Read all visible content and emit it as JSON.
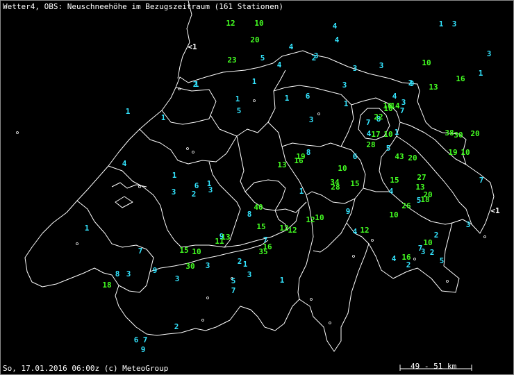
{
  "title": "Wetter4, OBS: Neuschneehöhe im Bezugszeitraum (161 Stationen)",
  "footer": "So, 17.01.2016 06:00z (c) MeteoGroup",
  "scale_label": "49 - 51 km",
  "colors": {
    "cyan": "#33e5ff",
    "green": "#44ff22",
    "white": "#ffffff"
  },
  "stations": [
    {
      "t": "12",
      "c": "g"
    },
    {
      "t": "10",
      "c": "g"
    },
    {
      "t": "20",
      "c": "g"
    },
    {
      "t": "23",
      "c": "g"
    },
    {
      "t": "5",
      "c": "c"
    },
    {
      "t": "4",
      "c": "c"
    },
    {
      "t": "3",
      "c": "c"
    },
    {
      "t": "4",
      "c": "c"
    },
    {
      "t": "1",
      "c": "c"
    },
    {
      "t": "1",
      "c": "c"
    },
    {
      "t": "4",
      "c": "c"
    },
    {
      "t": "4",
      "c": "c"
    },
    {
      "t": "3",
      "c": "c"
    },
    {
      "t": "2",
      "c": "c"
    },
    {
      "t": "3",
      "c": "c"
    },
    {
      "t": "<1",
      "c": "w"
    },
    {
      "t": "2",
      "c": "c"
    },
    {
      "t": "1",
      "c": "c"
    },
    {
      "t": "3",
      "c": "c"
    },
    {
      "t": "3",
      "c": "c"
    },
    {
      "t": "1",
      "c": "c"
    },
    {
      "t": "6",
      "c": "c"
    },
    {
      "t": "3",
      "c": "c"
    },
    {
      "t": "3",
      "c": "c"
    },
    {
      "t": "10",
      "c": "g"
    },
    {
      "t": "2",
      "c": "c"
    },
    {
      "t": "10",
      "c": "g"
    },
    {
      "t": "3",
      "c": "c"
    },
    {
      "t": "9",
      "c": "c"
    },
    {
      "t": "13",
      "c": "g"
    },
    {
      "t": "16",
      "c": "g"
    },
    {
      "t": "7",
      "c": "c"
    },
    {
      "t": "4",
      "c": "c"
    },
    {
      "t": "1",
      "c": "c"
    },
    {
      "t": "1",
      "c": "c"
    },
    {
      "t": "14",
      "c": "g"
    },
    {
      "t": "10",
      "c": "g"
    },
    {
      "t": "8",
      "c": "c"
    },
    {
      "t": "22",
      "c": "g"
    },
    {
      "t": "7",
      "c": "c"
    },
    {
      "t": "4",
      "c": "c"
    },
    {
      "t": "17",
      "c": "g"
    },
    {
      "t": "10",
      "c": "g"
    },
    {
      "t": "1",
      "c": "c"
    },
    {
      "t": "28",
      "c": "g"
    },
    {
      "t": "5",
      "c": "c"
    },
    {
      "t": "43",
      "c": "g"
    },
    {
      "t": "20",
      "c": "g"
    },
    {
      "t": "38",
      "c": "g"
    },
    {
      "t": "30",
      "c": "g"
    },
    {
      "t": "20",
      "c": "g"
    },
    {
      "t": "19",
      "c": "g"
    },
    {
      "t": "10",
      "c": "g"
    },
    {
      "t": "1",
      "c": "c"
    },
    {
      "t": "1",
      "c": "c"
    },
    {
      "t": "4",
      "c": "c"
    },
    {
      "t": "1",
      "c": "c"
    },
    {
      "t": "3",
      "c": "c"
    },
    {
      "t": "6",
      "c": "c"
    },
    {
      "t": "2",
      "c": "c"
    },
    {
      "t": "1",
      "c": "c"
    },
    {
      "t": "3",
      "c": "c"
    },
    {
      "t": "13",
      "c": "g"
    },
    {
      "t": "16",
      "c": "g"
    },
    {
      "t": "19",
      "c": "g"
    },
    {
      "t": "8",
      "c": "c"
    },
    {
      "t": "6",
      "c": "c"
    },
    {
      "t": "10",
      "c": "g"
    },
    {
      "t": "1",
      "c": "c"
    },
    {
      "t": "34",
      "c": "g"
    },
    {
      "t": "28",
      "c": "g"
    },
    {
      "t": "15",
      "c": "g"
    },
    {
      "t": "15",
      "c": "g"
    },
    {
      "t": "4",
      "c": "c"
    },
    {
      "t": "27",
      "c": "g"
    },
    {
      "t": "13",
      "c": "g"
    },
    {
      "t": "20",
      "c": "g"
    },
    {
      "t": "5",
      "c": "c"
    },
    {
      "t": "18",
      "c": "g"
    },
    {
      "t": "26",
      "c": "g"
    },
    {
      "t": "10",
      "c": "g"
    },
    {
      "t": "7",
      "c": "c"
    },
    {
      "t": "<1",
      "c": "w"
    },
    {
      "t": "3",
      "c": "c"
    },
    {
      "t": "1",
      "c": "c"
    },
    {
      "t": "5",
      "c": "c"
    },
    {
      "t": "40",
      "c": "g"
    },
    {
      "t": "8",
      "c": "c"
    },
    {
      "t": "15",
      "c": "g"
    },
    {
      "t": "12",
      "c": "g"
    },
    {
      "t": "12",
      "c": "g"
    },
    {
      "t": "12",
      "c": "g"
    },
    {
      "t": "10",
      "c": "g"
    },
    {
      "t": "9",
      "c": "c"
    },
    {
      "t": "4",
      "c": "c"
    },
    {
      "t": "12",
      "c": "g"
    },
    {
      "t": "7",
      "c": "c"
    },
    {
      "t": "15",
      "c": "g"
    },
    {
      "t": "10",
      "c": "g"
    },
    {
      "t": "9",
      "c": "c"
    },
    {
      "t": "11",
      "c": "g"
    },
    {
      "t": "9",
      "c": "c"
    },
    {
      "t": "13",
      "c": "g"
    },
    {
      "t": "7",
      "c": "c"
    },
    {
      "t": "16",
      "c": "g"
    },
    {
      "t": "35",
      "c": "g"
    },
    {
      "t": "30",
      "c": "g"
    },
    {
      "t": "3",
      "c": "c"
    },
    {
      "t": "2",
      "c": "c"
    },
    {
      "t": "1",
      "c": "c"
    },
    {
      "t": "3",
      "c": "c"
    },
    {
      "t": "8",
      "c": "c"
    },
    {
      "t": "3",
      "c": "c"
    },
    {
      "t": "1",
      "c": "c"
    },
    {
      "t": "5",
      "c": "c"
    },
    {
      "t": "7",
      "c": "c"
    },
    {
      "t": "1",
      "c": "c"
    },
    {
      "t": "18",
      "c": "g"
    },
    {
      "t": "2",
      "c": "c"
    },
    {
      "t": "6",
      "c": "c"
    },
    {
      "t": "7",
      "c": "c"
    },
    {
      "t": "9",
      "c": "c"
    },
    {
      "t": "2",
      "c": "c"
    },
    {
      "t": "10",
      "c": "g"
    },
    {
      "t": "7",
      "c": "c"
    },
    {
      "t": "3",
      "c": "c"
    },
    {
      "t": "2",
      "c": "c"
    },
    {
      "t": "4",
      "c": "c"
    },
    {
      "t": "16",
      "c": "g"
    },
    {
      "t": "2",
      "c": "c"
    },
    {
      "t": "5",
      "c": "c"
    },
    {
      "t": "3",
      "c": "c"
    }
  ]
}
